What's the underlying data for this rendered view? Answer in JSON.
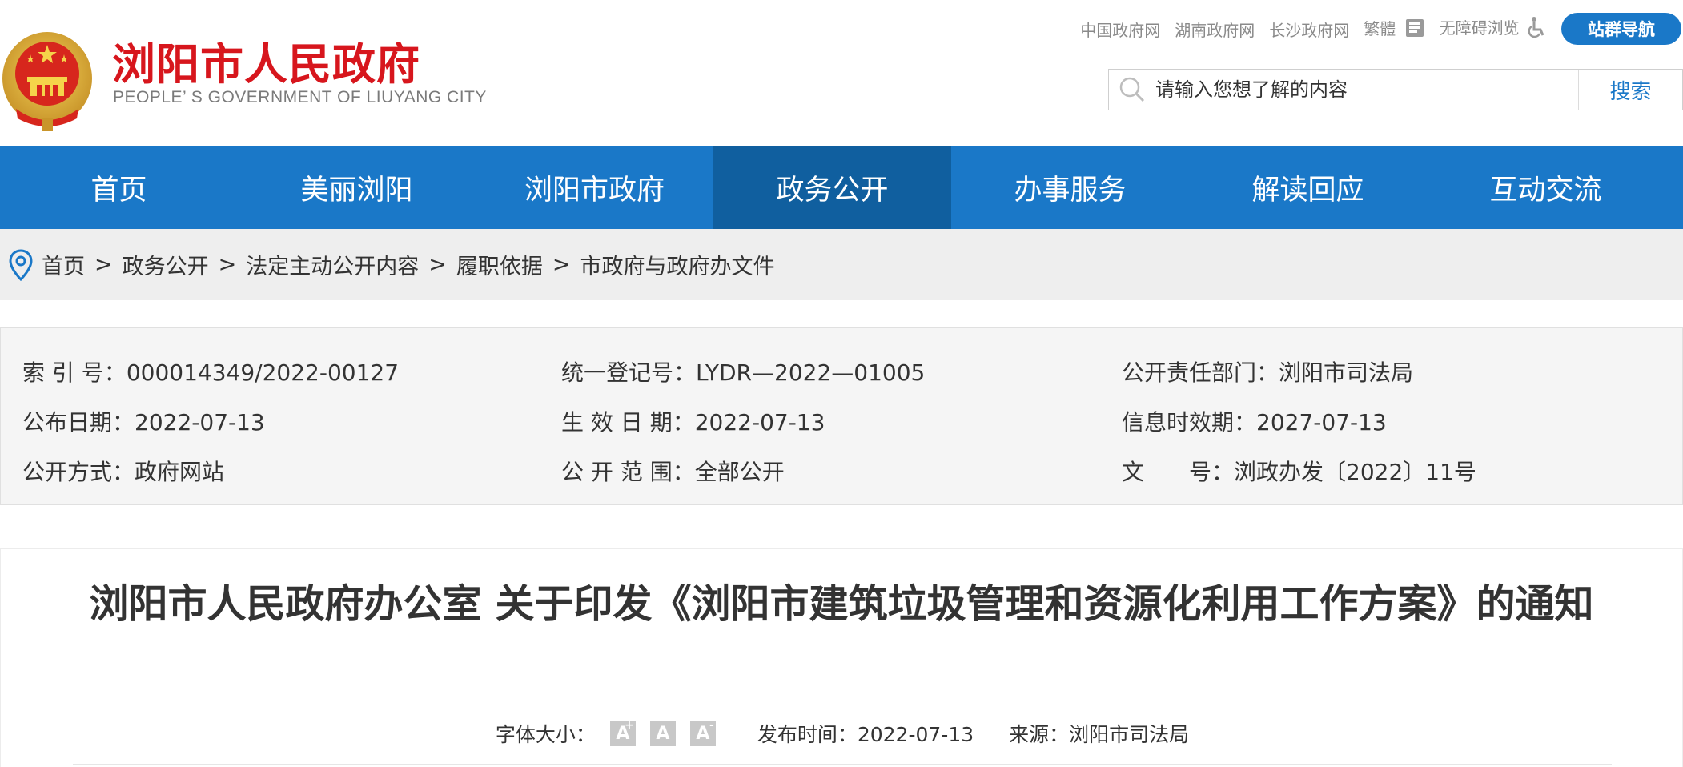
{
  "header": {
    "title": "浏阳市人民政府",
    "subtitle": "PEOPLE’ S GOVERNMENT OF LIUYANG CITY",
    "emblem_icon": "national-emblem-icon",
    "top_links": [
      "中国政府网",
      "湖南政府网",
      "长沙政府网",
      "繁體",
      "无障碍浏览"
    ],
    "nav_button": "站群导航",
    "search_placeholder": "请输入您想了解的内容",
    "search_button": "搜索"
  },
  "main_nav": {
    "items": [
      "首页",
      "美丽浏阳",
      "浏阳市政府",
      "政务公开",
      "办事服务",
      "解读回应",
      "互动交流"
    ],
    "active": "政务公开"
  },
  "breadcrumb": {
    "icon": "location-pin-icon",
    "items": [
      "首页",
      "政务公开",
      "法定主动公开内容",
      "履职依据",
      "市政府与政府办文件"
    ],
    "separator": ">"
  },
  "info": {
    "index_label": "索 引 号：",
    "index_value": "000014349/2022-00127",
    "reg_label": "统一登记号：",
    "reg_value": "LYDR—2022—01005",
    "dept_label": "公开责任部门：",
    "dept_value": "浏阳市司法局",
    "pubdate_label": "公布日期：",
    "pubdate_value": "2022-07-13",
    "effdate_label": "生 效 日 期：",
    "effdate_value": "2022-07-13",
    "validity_label": "信息时效期：",
    "validity_value": "2027-07-13",
    "method_label": "公开方式：",
    "method_value": "政府网站",
    "scope_label": "公 开 范 围：",
    "scope_value": "全部公开",
    "docno_label": "文　　号：",
    "docno_value": "浏政办发〔2022〕11号"
  },
  "article": {
    "title": "浏阳市人民政府办公室 关于印发《浏阳市建筑垃圾管理和资源化利用工作方案》的通知",
    "font_size_label": "字体大小：",
    "font_buttons": [
      "A",
      "A",
      "A"
    ],
    "pub_time_label": "发布时间：",
    "pub_time": "2022-07-13",
    "source_label": "来源：",
    "source": "浏阳市司法局"
  },
  "colors": {
    "brand_red": "#d7161d",
    "nav_blue": "#1a78c8",
    "nav_active": "#105f9f",
    "breadcrumb_bg": "#eeeeee",
    "info_bg": "#f5f5f5"
  }
}
